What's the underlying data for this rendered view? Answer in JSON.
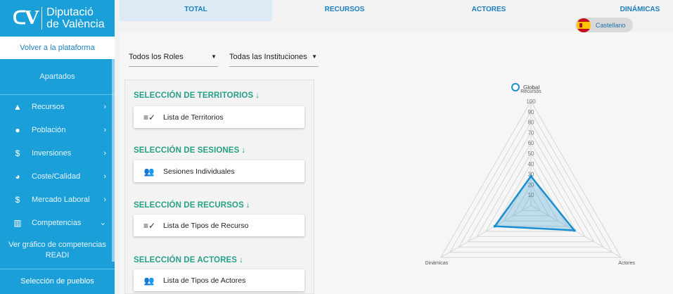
{
  "sidebar": {
    "logo_mark": "ᑕV",
    "logo_line1": "Diputació",
    "logo_line2": "de València",
    "back_label": "Volver a la plataforma",
    "sections_title": "Apartados",
    "items": [
      {
        "label": "Recursos",
        "icon": "mountain-icon",
        "glyph": "▲",
        "chevron": "›"
      },
      {
        "label": "Población",
        "icon": "person-icon",
        "glyph": "●",
        "chevron": "›"
      },
      {
        "label": "Inversiones",
        "icon": "dollar-icon",
        "glyph": "$",
        "chevron": "›"
      },
      {
        "label": "Coste/Calidad",
        "icon": "pie-chart-icon",
        "glyph": "◕",
        "chevron": "›"
      },
      {
        "label": "Mercado Laboral",
        "icon": "dollar-icon",
        "glyph": "$",
        "chevron": "›"
      },
      {
        "label": "Competencias",
        "icon": "bar-chart-icon",
        "glyph": "▥",
        "chevron": "⌄"
      }
    ],
    "competencias_link": "Ver gráfico de competencias READI",
    "pueblos_label": "Selección de pueblos"
  },
  "tabs": [
    {
      "label": "TOTAL",
      "active": true
    },
    {
      "label": "RECURSOS",
      "active": false
    },
    {
      "label": "ACTORES",
      "active": false
    },
    {
      "label": "DINÁMICAS",
      "active": false
    }
  ],
  "language": {
    "label": "Castellano",
    "flag": "spain-flag-icon"
  },
  "filters": {
    "roles": "Todos los Roles",
    "instituciones": "Todas las Instituciones",
    "arrow": "▼"
  },
  "groups": [
    {
      "title": "SELECCIÓN DE TERRITORIOS",
      "arrow": "↓",
      "card": "Lista de Territorios",
      "icon": "checklist-icon",
      "glyph": "≡✓"
    },
    {
      "title": "SELECCIÓN DE SESIONES",
      "arrow": "↓",
      "card": "Sesiones Individuales",
      "icon": "people-outline-icon",
      "glyph": "👥"
    },
    {
      "title": "SELECCIÓN DE RECURSOS",
      "arrow": "↓",
      "card": "Lista de Tipos de Recurso",
      "icon": "checklist-icon",
      "glyph": "≡✓"
    },
    {
      "title": "SELECCIÓN DE ACTORES",
      "arrow": "↓",
      "card": "Lista de Tipos de Actores",
      "icon": "people-icon",
      "glyph": "👥"
    }
  ],
  "chart_data": {
    "type": "radar",
    "axes": [
      "Recursos",
      "Actores",
      "Dinámicas"
    ],
    "range": [
      0,
      100
    ],
    "ticks": [
      10,
      20,
      30,
      40,
      50,
      60,
      70,
      80,
      90,
      100
    ],
    "series": [
      {
        "name": "Global",
        "values": [
          28,
          48,
          40
        ]
      }
    ],
    "color": "#1a8fd0"
  }
}
